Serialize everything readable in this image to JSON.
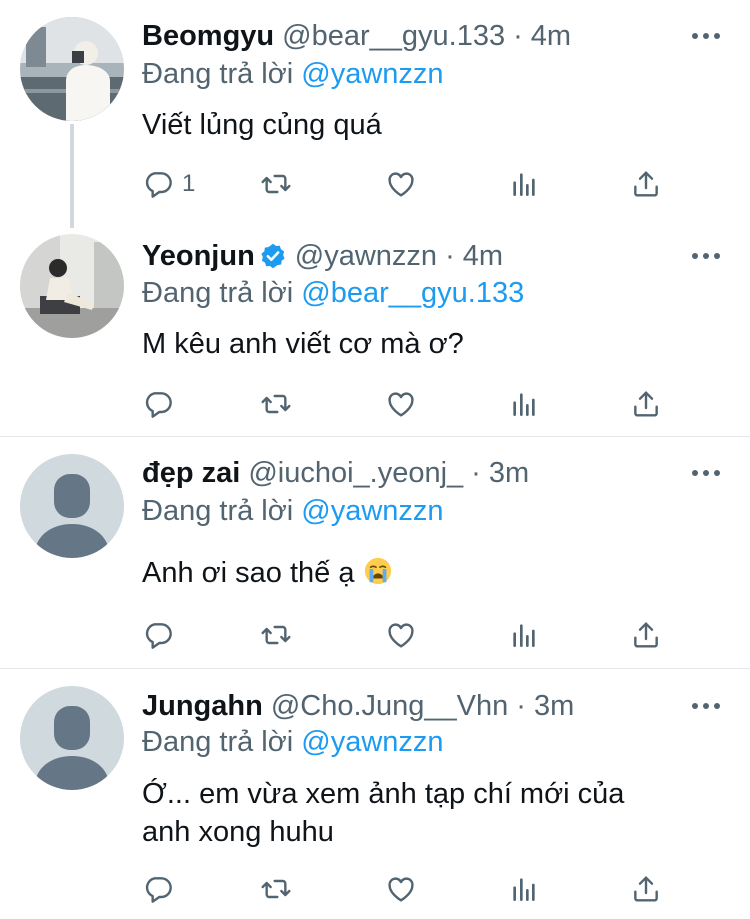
{
  "colors": {
    "accent": "#1d9bf0",
    "secondary_text": "#536471",
    "primary_text": "#0f1419",
    "divider": "#e3e7ea"
  },
  "tweets": [
    {
      "name": "Beomgyu",
      "handle": "@bear__gyu.133",
      "separator": "·",
      "time": "4m",
      "replying_prefix": "Đang trả lời",
      "replying_to": "@yawnzzn",
      "text": "Viết lủng củng quá",
      "reply_count": "1",
      "verified": false,
      "avatar": "photo-avatar"
    },
    {
      "name": "Yeonjun",
      "handle": "@yawnzzn",
      "separator": "·",
      "time": "4m",
      "replying_prefix": "Đang trả lời",
      "replying_to": "@bear__gyu.133",
      "text": "M kêu anh viết cơ mà ơ?",
      "reply_count": "",
      "verified": true,
      "avatar": "photo-avatar"
    },
    {
      "name": "đẹp zai",
      "handle": "@iuchoi_.yeonj_",
      "separator": "·",
      "time": "3m",
      "replying_prefix": "Đang trả lời",
      "replying_to": "@yawnzzn",
      "text": "Anh ơi sao thế ạ",
      "emoji": "loudly-crying-face-emoji",
      "reply_count": "",
      "verified": false,
      "avatar": "default-avatar"
    },
    {
      "name": "Jungahn",
      "handle": "@Cho.Jung__Vhn",
      "separator": "·",
      "time": "3m",
      "replying_prefix": "Đang trả lời",
      "replying_to": "@yawnzzn",
      "text_line1": "Ớ... em vừa xem ảnh tạp chí mới của",
      "text_line2": "anh xong huhu",
      "reply_count": "",
      "verified": false,
      "avatar": "default-avatar"
    }
  ],
  "icons": [
    "reply-icon",
    "retweet-icon",
    "like-icon",
    "analytics-icon",
    "share-icon",
    "more-icon",
    "verified-icon"
  ]
}
